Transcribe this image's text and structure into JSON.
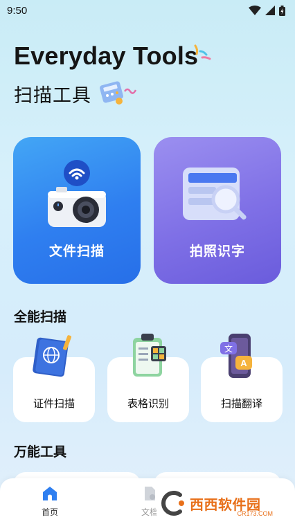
{
  "status": {
    "time": "9:50"
  },
  "header": {
    "title": "Everyday Tools",
    "subtitle": "扫描工具"
  },
  "main_cards": [
    {
      "label": "文件扫描"
    },
    {
      "label": "拍照识字"
    }
  ],
  "section_scan": {
    "title": "全能扫描",
    "items": [
      {
        "label": "证件扫描"
      },
      {
        "label": "表格识别"
      },
      {
        "label": "扫描翻译"
      }
    ]
  },
  "section_tools": {
    "title": "万能工具"
  },
  "bottom_nav": [
    {
      "label": "首页",
      "active": true
    },
    {
      "label": "文档",
      "active": false
    }
  ],
  "watermark": {
    "text": "西西软件园",
    "sub": "CR173.COM"
  },
  "colors": {
    "scan_card": "#2f7ff0",
    "ocr_card": "#7f70e6",
    "nav_active": "#2f7ff0"
  }
}
